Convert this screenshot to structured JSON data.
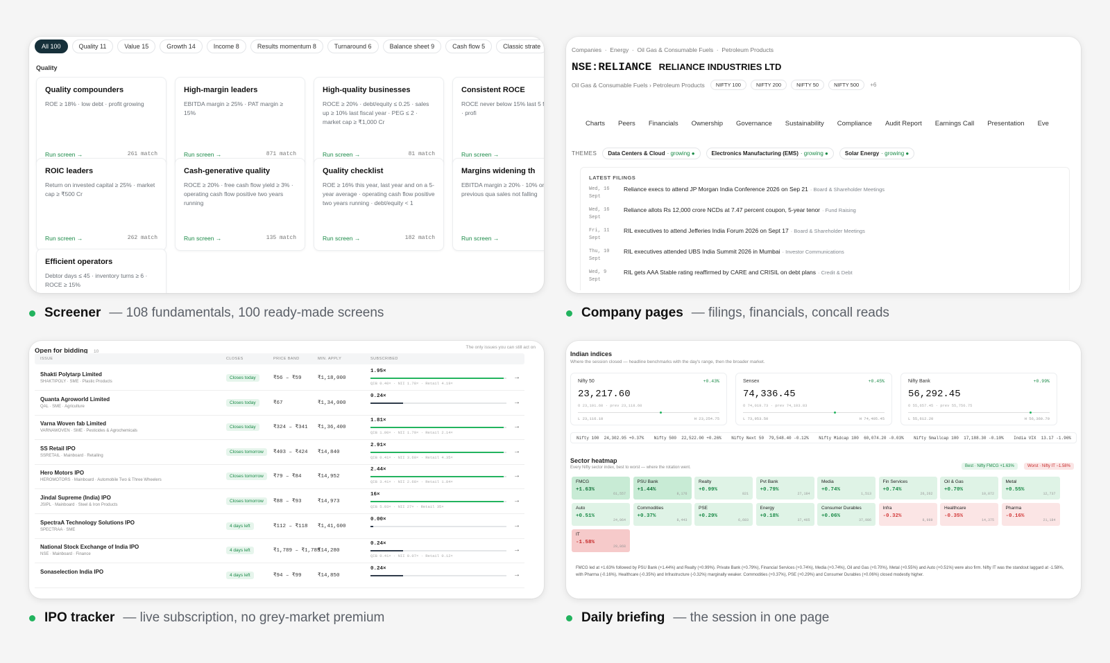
{
  "screener": {
    "chips": [
      "All 100",
      "Quality 11",
      "Value 15",
      "Growth 14",
      "Income 8",
      "Results momentum 8",
      "Turnaround 6",
      "Balance sheet 9",
      "Cash flow 5",
      "Classic strate"
    ],
    "section": "Quality",
    "run": "Run screen",
    "cards": [
      {
        "title": "Quality compounders",
        "desc": "ROE ≥ 18% · low debt · profit growing",
        "match": "261 match"
      },
      {
        "title": "High-margin leaders",
        "desc": "EBITDA margin ≥ 25% · PAT margin ≥ 15%",
        "match": "871 match"
      },
      {
        "title": "High-quality businesses",
        "desc": "ROCE ≥ 20% · debt/equity ≤ 0.25 · sales up ≥ 10% last fiscal year · PEG ≤ 2 · market cap ≥ ₹1,000 Cr",
        "match": "81 match"
      },
      {
        "title": "Consistent ROCE",
        "desc": "ROCE never below 15% last 5 fiscal years · profi",
        "match": ""
      },
      {
        "title": "ROIC leaders",
        "desc": "Return on invested capital ≥ 25% · market cap ≥ ₹500 Cr",
        "match": "262 match"
      },
      {
        "title": "Cash-generative quality",
        "desc": "ROCE ≥ 20% · free cash flow yield ≥ 3% · operating cash flow positive two years running",
        "match": "135 match"
      },
      {
        "title": "Quality checklist",
        "desc": "ROE ≥ 16% this year, last year and on a 5-year average · operating cash flow positive two years running · debt/equity < 1",
        "match": "182 match"
      },
      {
        "title": "Margins widening th",
        "desc": "EBITDA margin ≥ 20% · 10% on the previous qua sales not falling",
        "match": ""
      },
      {
        "title": "Efficient operators",
        "desc": "Debtor days ≤ 45 · inventory turns ≥ 6 · ROCE ≥ 15%",
        "match": ""
      }
    ],
    "caption_title": "Screener",
    "caption_sub": "— 108 fundamentals, 100 ready-made screens"
  },
  "company": {
    "breadcrumb": "Companies  ·  Energy  ·  Oil Gas & Consumable Fuels  ·  Petroleum Products",
    "ticker": "NSE:RELIANCE",
    "name": "RELIANCE INDUSTRIES LTD",
    "industry": "Oil Gas & Consumable Fuels › Petroleum Products",
    "indices": [
      "NIFTY 100",
      "NIFTY 200",
      "NIFTY 50",
      "NIFTY 500"
    ],
    "more": "+6",
    "tabs": [
      "Charts",
      "Peers",
      "Financials",
      "Ownership",
      "Governance",
      "Sustainability",
      "Compliance",
      "Audit Report",
      "Earnings Call",
      "Presentation",
      "Eve"
    ],
    "themes_label": "THEMES",
    "themes": [
      {
        "name": "Data Centers & Cloud",
        "state": "· growing ●"
      },
      {
        "name": "Electronics Manufacturing (EMS)",
        "state": "· growing ●"
      },
      {
        "name": "Solar Energy",
        "state": "· growing ●"
      }
    ],
    "filings_label": "LATEST FILINGS",
    "filings": [
      {
        "date": "Wed, 16 Sept",
        "text": "Reliance execs to attend JP Morgan India Conference 2026 on Sep 21",
        "tag": "· Board & Shareholder Meetings"
      },
      {
        "date": "Wed, 16 Sept",
        "text": "Reliance allots Rs 12,000 crore NCDs at 7.47 percent coupon, 5-year tenor",
        "tag": "· Fund Raising"
      },
      {
        "date": "Fri, 11 Sept",
        "text": "RIL executives to attend Jefferies India Forum 2026 on Sept 17",
        "tag": "· Board & Shareholder Meetings"
      },
      {
        "date": "Thu, 10 Sept",
        "text": "RIL executives attended UBS India Summit 2026 in Mumbai",
        "tag": "· Investor Communications"
      },
      {
        "date": "Wed, 9 Sept",
        "text": "RIL gets AAA Stable rating reaffirmed by CARE and CRISIL on debt plans",
        "tag": "· Credit & Debt"
      }
    ],
    "caption_title": "Company pages",
    "caption_sub": "— filings, financials, concall reads"
  },
  "ipo": {
    "title": "Open for bidding",
    "count": "10",
    "note": "The only issues you can still act on",
    "headers": [
      "ISSUE",
      "CLOSES",
      "PRICE BAND",
      "MIN. APPLY",
      "SUBSCRIBED"
    ],
    "rows": [
      {
        "name": "Shakti Polytarp Limited",
        "meta": "SHAKTIPOLY · SME · Plastic Products",
        "closes": "Closes today",
        "band": "₹56 – ₹59",
        "min": "₹1,18,000",
        "sub": "1.95×",
        "fill": 0.98,
        "detail": "QIB 0.40× · NII 1.78× · Retail 4.19×"
      },
      {
        "name": "Quanta Agroworld Limited",
        "meta": "QAL · SME · Agriculture",
        "closes": "Closes today",
        "band": "₹67",
        "min": "₹1,34,000",
        "sub": "0.24×",
        "fill": 0.24,
        "detail": ""
      },
      {
        "name": "Varna Woven fab Limited",
        "meta": "VARNAWOVEN · SME · Pesticides & Agrochemicals",
        "closes": "Closes today",
        "band": "₹324 – ₹341",
        "min": "₹1,36,400",
        "sub": "1.81×",
        "fill": 0.98,
        "detail": "QIB 1.00× · NII 1.79× · Retail 2.14×"
      },
      {
        "name": "SS Retail IPO",
        "meta": "SSRETAIL · Mainboard · Retailing",
        "closes": "Closes tomorrow",
        "band": "₹403 – ₹424",
        "min": "₹14,840",
        "sub": "2.91×",
        "fill": 0.98,
        "detail": "QIB 0.41× · NII 3.60× · Retail 4.35×"
      },
      {
        "name": "Hero Motors IPO",
        "meta": "HEROMOTORS · Mainboard · Automobile Two & Three Wheelers",
        "closes": "Closes tomorrow",
        "band": "₹79 – ₹84",
        "min": "₹14,952",
        "sub": "2.44×",
        "fill": 0.98,
        "detail": "QIB 3.41× · NII 2.68× · Retail 1.84×"
      },
      {
        "name": "Jindal Supreme (India) IPO",
        "meta": "JSIPL · Mainboard · Steel & Iron Products",
        "closes": "Closes tomorrow",
        "band": "₹88 – ₹93",
        "min": "₹14,973",
        "sub": "16×",
        "fill": 0.98,
        "detail": "QIB 5.93× · NII 27× · Retail 35×"
      },
      {
        "name": "SpectraA Technology Solutions IPO",
        "meta": "SPECTRAA · SME",
        "closes": "4 days left",
        "band": "₹112 – ₹118",
        "min": "₹1,41,600",
        "sub": "0.00×",
        "fill": 0.02,
        "detail": ""
      },
      {
        "name": "National Stock Exchange of India IPO",
        "meta": "NSE · Mainboard · Finance",
        "closes": "4 days left",
        "band": "₹1,789 – ₹1,785",
        "min": "₹14,280",
        "sub": "0.24×",
        "fill": 0.24,
        "detail": "QIB 0.41× · NII 0.07× · Retail 0.12×"
      },
      {
        "name": "Sonaselection India IPO",
        "meta": "",
        "closes": "4 days left",
        "band": "₹94 – ₹99",
        "min": "₹14,850",
        "sub": "0.24×",
        "fill": 0.24,
        "detail": ""
      }
    ],
    "caption_title": "IPO tracker",
    "caption_sub": "— live subscription, no grey-market premium"
  },
  "briefing": {
    "title": "Indian indices",
    "subtitle": "Where the session closed — headline benchmarks with the day's range, then the broader market.",
    "indices": [
      {
        "name": "Nifty 50",
        "chg": "+0.43%",
        "value": "23,217.60",
        "sub": "O 23,101.60 · prev 23,118.60",
        "range_pos": 0.58,
        "low": "L 23,116.10",
        "high": "H 23,254.75"
      },
      {
        "name": "Sensex",
        "chg": "+0.45%",
        "value": "74,336.45",
        "sub": "O 74,019.73 · prev 74,103.83",
        "range_pos": 0.64,
        "low": "L 73,953.50",
        "high": "H 74,405.45"
      },
      {
        "name": "Nifty Bank",
        "chg": "+0.99%",
        "value": "56,292.45",
        "sub": "O 55,657.45 · prev 55,756.75",
        "range_pos": 0.86,
        "low": "L 55,612.20",
        "high": "H 56,360.70"
      }
    ],
    "broad": "Nifty 100  24,302.95 +0.37%    Nifty 500  22,522.00 +0.26%    Nifty Next 50  79,548.40 -0.12%    Nifty Midcap 100  60,074.20 -0.03%    Nifty Smallcap 100  17,188.30 -0.10%    India VIX  13.17 -1.96%",
    "heatmap_title": "Sector heatmap",
    "heatmap_sub": "Every Nifty sector index, best to worst — where the rotation went.",
    "best": "Best · Nifty FMCG +1.63%",
    "worst": "Worst · Nifty IT −1.58%",
    "sectors": [
      {
        "name": "FMCG",
        "chg": "+1.63%",
        "val": "61,557",
        "tone": "up2"
      },
      {
        "name": "PSU Bank",
        "chg": "+1.44%",
        "val": "8,176",
        "tone": "up2"
      },
      {
        "name": "Realty",
        "chg": "+0.99%",
        "val": "821",
        "tone": "up"
      },
      {
        "name": "Pvt Bank",
        "chg": "+0.79%",
        "val": "27,184",
        "tone": "up"
      },
      {
        "name": "Media",
        "chg": "+0.74%",
        "val": "1,513",
        "tone": "up"
      },
      {
        "name": "Fin Services",
        "chg": "+0.74%",
        "val": "26,262",
        "tone": "up"
      },
      {
        "name": "Oil & Gas",
        "chg": "+0.70%",
        "val": "10,872",
        "tone": "up"
      },
      {
        "name": "Metal",
        "chg": "+0.55%",
        "val": "12,737",
        "tone": "up"
      },
      {
        "name": "Auto",
        "chg": "+0.51%",
        "val": "24,064",
        "tone": "up"
      },
      {
        "name": "Commodities",
        "chg": "+0.37%",
        "val": "8,443",
        "tone": "up"
      },
      {
        "name": "PSE",
        "chg": "+0.29%",
        "val": "6,683",
        "tone": "up"
      },
      {
        "name": "Energy",
        "chg": "+0.18%",
        "val": "37,465",
        "tone": "up"
      },
      {
        "name": "Consumer Durables",
        "chg": "+0.06%",
        "val": "37,986",
        "tone": "up"
      },
      {
        "name": "Infra",
        "chg": "-0.32%",
        "val": "8,989",
        "tone": "dn"
      },
      {
        "name": "Healthcare",
        "chg": "-0.35%",
        "val": "14,375",
        "tone": "dn"
      },
      {
        "name": "Pharma",
        "chg": "-0.16%",
        "val": "21,184",
        "tone": "dn"
      },
      {
        "name": "IT",
        "chg": "-1.58%",
        "val": "29,868",
        "tone": "dn2"
      }
    ],
    "summary": "FMCG led at +1.63% followed by PSU Bank (+1.44%) and Realty (+0.99%). Private Bank (+0.79%), Financial Services (+0.74%), Media (+0.74%), Oil and Gas (+0.70%), Metal (+0.55%) and Auto (+0.51%) were also firm. Nifty IT was the standout laggard at -1.58%, with Pharma (-0.16%), Healthcare (-0.35%) and Infrastructure (-0.32%) marginally weaker. Commodities (+0.37%), PSE (+0.29%) and Consumer Durables (+0.06%) closed modestly higher.",
    "caption_title": "Daily briefing",
    "caption_sub": "— the session in one page"
  }
}
